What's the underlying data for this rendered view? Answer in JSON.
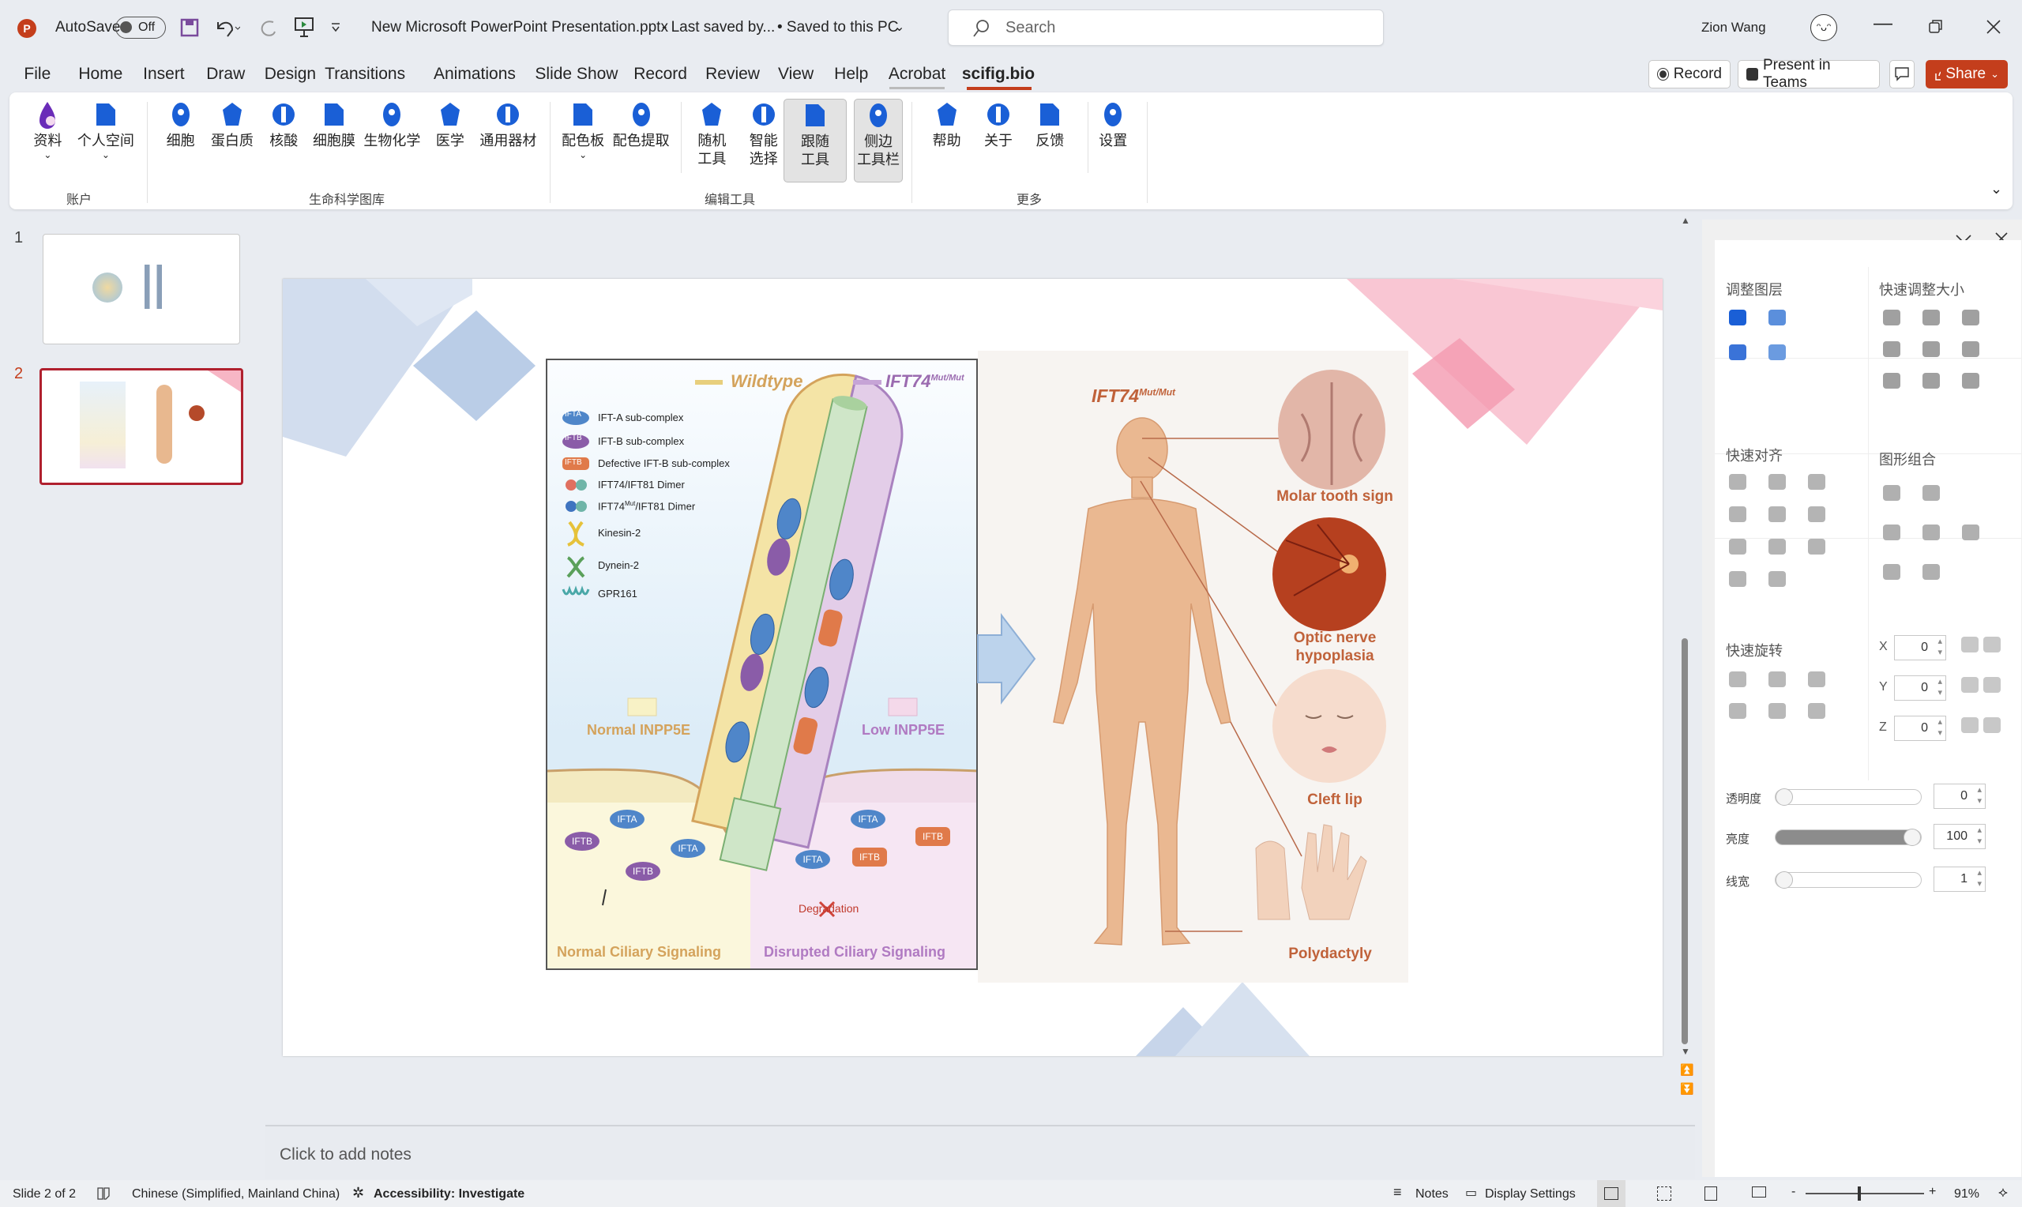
{
  "titlebar": {
    "autosave_label": "AutoSave",
    "autosave_state": "Off",
    "document_title": "New Microsoft PowerPoint Presentation.pptx",
    "save_status_prefix": "-  Last saved by...",
    "save_status": "• Saved to this PC",
    "search_placeholder": "Search",
    "user_name": "Zion Wang"
  },
  "tabs": [
    "File",
    "Home",
    "Insert",
    "Draw",
    "Design",
    "Transitions",
    "Animations",
    "Slide Show",
    "Record",
    "Review",
    "View",
    "Help",
    "Acrobat",
    "scifig.bio"
  ],
  "active_tab": "scifig.bio",
  "top_buttons": {
    "record": "Record",
    "present_teams": "Present in Teams",
    "share": "Share"
  },
  "ribbon": {
    "items": [
      {
        "label": "资料",
        "icon": "document-drop-icon",
        "dropdown": true
      },
      {
        "label": "个人空间",
        "icon": "folder-cloud-icon",
        "dropdown": true
      },
      {
        "label": "细胞",
        "icon": "cell-icon"
      },
      {
        "label": "蛋白质",
        "icon": "protein-icon"
      },
      {
        "label": "核酸",
        "icon": "dna-icon"
      },
      {
        "label": "细胞膜",
        "icon": "membrane-icon"
      },
      {
        "label": "生物化学",
        "icon": "flask-icon"
      },
      {
        "label": "医学",
        "icon": "medical-icon"
      },
      {
        "label": "通用器材",
        "icon": "microscope-icon"
      },
      {
        "label": "配色板",
        "icon": "palette-stack-icon",
        "dropdown": true
      },
      {
        "label": "配色提取",
        "icon": "palette-icon"
      },
      {
        "label": "随机\n工具",
        "icon": "shuffle-icon"
      },
      {
        "label": "智能\n选择",
        "icon": "smart-select-icon"
      },
      {
        "label": "跟随\n工具",
        "icon": "follow-tool-icon",
        "selected": true
      },
      {
        "label": "侧边\n工具栏",
        "icon": "sidebar-icon",
        "selected": true
      },
      {
        "label": "帮助",
        "icon": "help-icon"
      },
      {
        "label": "关于",
        "icon": "info-icon"
      },
      {
        "label": "反馈",
        "icon": "feedback-icon"
      },
      {
        "label": "设置",
        "icon": "gear-icon"
      }
    ],
    "groups": [
      "账户",
      "生命科学图库",
      "编辑工具",
      "更多"
    ]
  },
  "slides": [
    {
      "number": "1"
    },
    {
      "number": "2",
      "selected": true
    }
  ],
  "figure": {
    "wildtype": "Wildtype",
    "mutant": "IFT74",
    "mutant_sup": "Mut/Mut",
    "legend": [
      {
        "badge": "IFTA",
        "text": "IFT-A sub-complex"
      },
      {
        "badge": "IFTB",
        "text": "IFT-B sub-complex"
      },
      {
        "badge": "IFTB",
        "text": "Defective IFT-B sub-complex"
      },
      {
        "text": "IFT74/IFT81 Dimer"
      },
      {
        "text": "IFT74",
        "sup": "Mut",
        "text2": "/IFT81 Dimer"
      },
      {
        "text": "Kinesin-2"
      },
      {
        "text": "Dynein-2"
      },
      {
        "text": "GPR161"
      }
    ],
    "normal_inpp5e": "Normal INPP5E",
    "low_inpp5e": "Low INPP5E",
    "normal_signaling": "Normal Ciliary Signaling",
    "disrupted_signaling": "Disrupted Ciliary Signaling",
    "degradation": "Degradation",
    "ifta": "IFTA",
    "iftb": "IFTB",
    "phenotypes": [
      "Molar tooth sign",
      "Optic nerve\nhypoplasia",
      "Cleft lip",
      "Polydactyly"
    ]
  },
  "colors": {
    "accent": "#c43e1c",
    "icon_blue": "#1a5fd6",
    "wildtype": "#d4a35c",
    "mutant": "#9b6bb0",
    "phenotype_label": "#c0623a"
  },
  "notes_placeholder": "Click to add notes",
  "side_pane": {
    "layer": "调整图层",
    "resize": "快速调整大小",
    "align": "快速对齐",
    "group": "图形组合",
    "rotate": "快速旋转",
    "x_label": "X",
    "y_label": "Y",
    "z_label": "Z",
    "x_value": "0",
    "y_value": "0",
    "z_value": "0",
    "opacity_label": "透明度",
    "opacity_value": "0",
    "opacity_fraction": 0,
    "brightness_label": "亮度",
    "brightness_value": "100",
    "brightness_fraction": 1,
    "linewidth_label": "线宽",
    "linewidth_value": "1",
    "linewidth_fraction": 0
  },
  "status": {
    "slide": "Slide 2 of 2",
    "language": "Chinese (Simplified, Mainland China)",
    "accessibility": "Accessibility: Investigate",
    "notes": "Notes",
    "display": "Display Settings",
    "zoom": "91%"
  }
}
